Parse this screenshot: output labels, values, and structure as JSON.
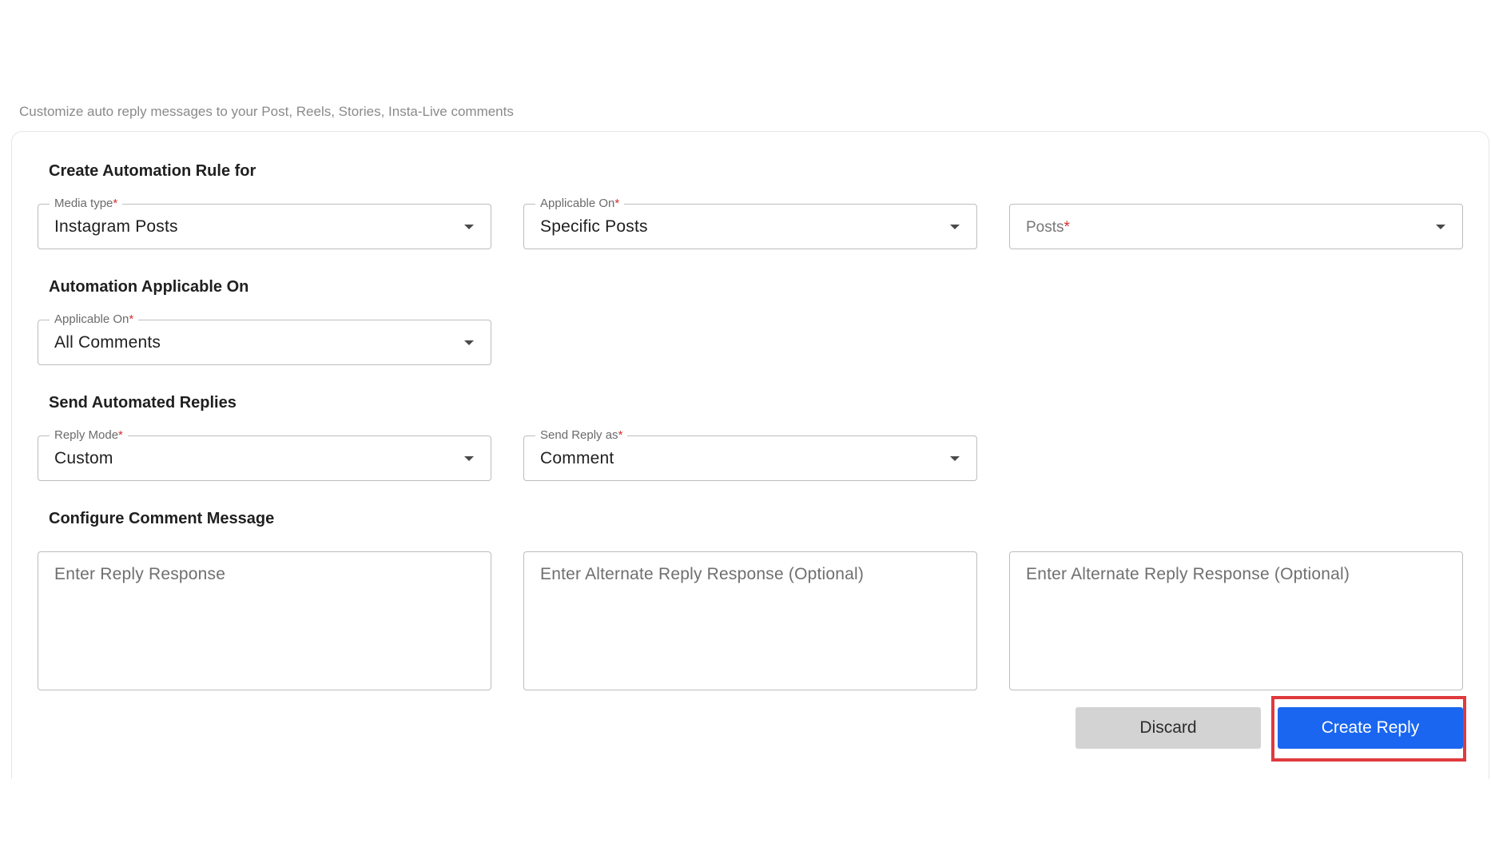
{
  "subtitle": "Customize auto reply messages to your Post, Reels, Stories, Insta-Live comments",
  "sections": {
    "rule_for": "Create Automation Rule for",
    "applicable_on": "Automation Applicable On",
    "send_replies": "Send Automated Replies",
    "configure_message": "Configure Comment Message"
  },
  "rule_for": {
    "media_type": {
      "label": "Media type",
      "required_mark": "*",
      "value": "Instagram Posts"
    },
    "applicable_on": {
      "label": "Applicable On",
      "required_mark": "*",
      "value": "Specific Posts"
    },
    "posts": {
      "placeholder": "Posts",
      "required_mark": "*"
    }
  },
  "automation_applicable_on": {
    "applicable_on": {
      "label": "Applicable On",
      "required_mark": "*",
      "value": "All Comments"
    }
  },
  "send_replies": {
    "reply_mode": {
      "label": "Reply Mode",
      "required_mark": "*",
      "value": "Custom"
    },
    "send_reply_as": {
      "label": "Send Reply as",
      "required_mark": "*",
      "value": "Comment"
    }
  },
  "comment_message": {
    "reply_placeholder": "Enter Reply Response",
    "alternate_1_placeholder": "Enter Alternate Reply Response (Optional)",
    "alternate_2_placeholder": "Enter Alternate Reply Response (Optional)"
  },
  "actions": {
    "discard_label": "Discard",
    "create_label": "Create Reply"
  },
  "colors": {
    "primary": "#1a66f0",
    "required": "#d32f2f",
    "highlight": "#e0393e"
  }
}
